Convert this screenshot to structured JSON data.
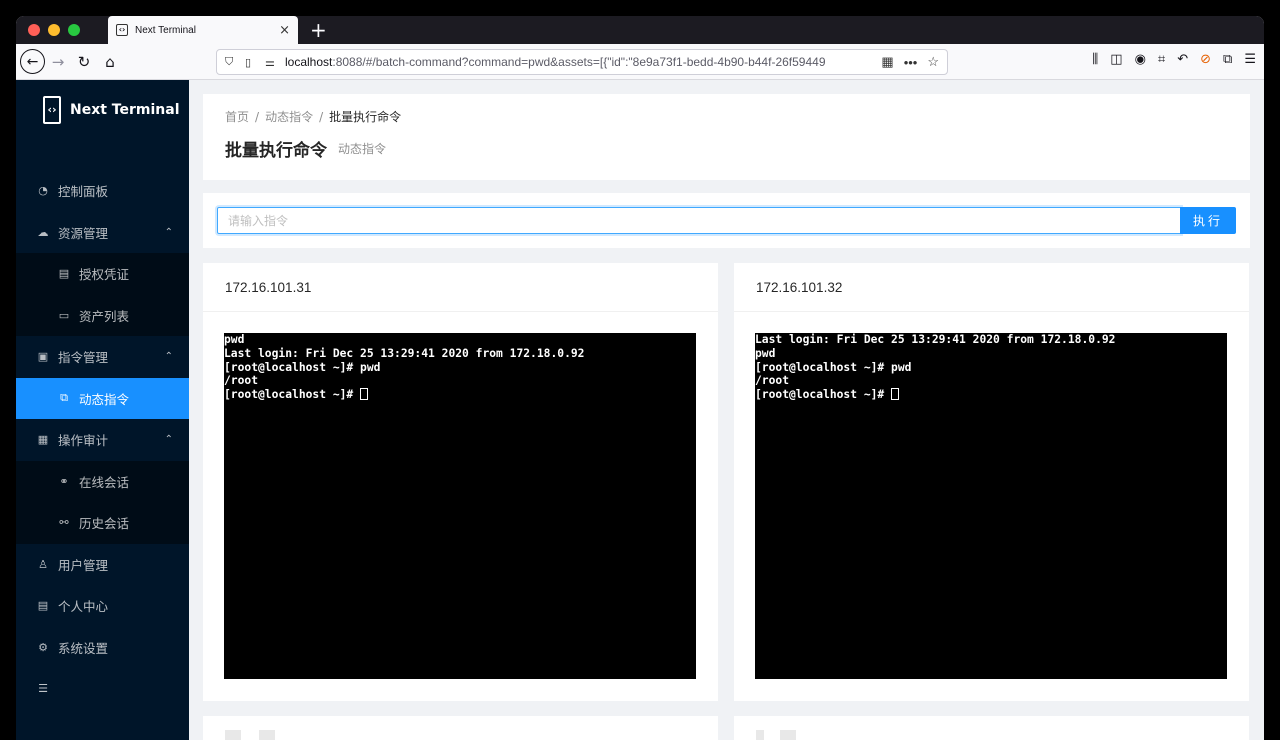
{
  "browser": {
    "tab_title": "Next Terminal",
    "tab_close": "×",
    "new_tab": "+",
    "url_host": "localhost",
    "url_rest": ":8088/#/batch-command?command=pwd&assets=[{\"id\":\"8e9a73f1-bedd-4b90-b44f-26f59449",
    "traffic_colors": [
      "#ff5f57",
      "#febc2e",
      "#28c840"
    ]
  },
  "sidebar": {
    "brand": "Next Terminal",
    "items": [
      {
        "label": "控制面板",
        "icon": "dashboard-icon",
        "glyph": "◔"
      },
      {
        "label": "资源管理",
        "icon": "cloud-icon",
        "glyph": "☁",
        "arrow": "⌃"
      },
      {
        "label": "授权凭证",
        "icon": "id-card-icon",
        "glyph": "▤"
      },
      {
        "label": "资产列表",
        "icon": "desktop-icon",
        "glyph": "▭"
      },
      {
        "label": "指令管理",
        "icon": "code-icon",
        "glyph": "▣",
        "arrow": "⌃"
      },
      {
        "label": "动态指令",
        "icon": "block-icon",
        "glyph": "⧉"
      },
      {
        "label": "操作审计",
        "icon": "audit-icon",
        "glyph": "▦",
        "arrow": "⌃"
      },
      {
        "label": "在线会话",
        "icon": "link-icon",
        "glyph": "⚭"
      },
      {
        "label": "历史会话",
        "icon": "disconnect-icon",
        "glyph": "⚯"
      },
      {
        "label": "用户管理",
        "icon": "user-icon",
        "glyph": "♙"
      },
      {
        "label": "个人中心",
        "icon": "profile-icon",
        "glyph": "▤"
      },
      {
        "label": "系统设置",
        "icon": "setting-icon",
        "glyph": "⚙"
      }
    ],
    "collapse_glyph": "☰"
  },
  "breadcrumb": [
    "首页",
    "动态指令",
    "批量执行命令"
  ],
  "page": {
    "title": "批量执行命令",
    "subtitle": "动态指令"
  },
  "command": {
    "placeholder": "请输入指令",
    "button": "执行"
  },
  "terminals": [
    {
      "host": "172.16.101.31",
      "lines": [
        "pwd",
        "Last login: Fri Dec 25 13:29:41 2020 from 172.18.0.92",
        "[root@localhost ~]# pwd",
        "/root",
        "[root@localhost ~]# "
      ]
    },
    {
      "host": "172.16.101.32",
      "lines": [
        "Last login: Fri Dec 25 13:29:41 2020 from 172.18.0.92",
        "pwd",
        "[root@localhost ~]# pwd",
        "/root",
        "[root@localhost ~]# "
      ]
    }
  ]
}
